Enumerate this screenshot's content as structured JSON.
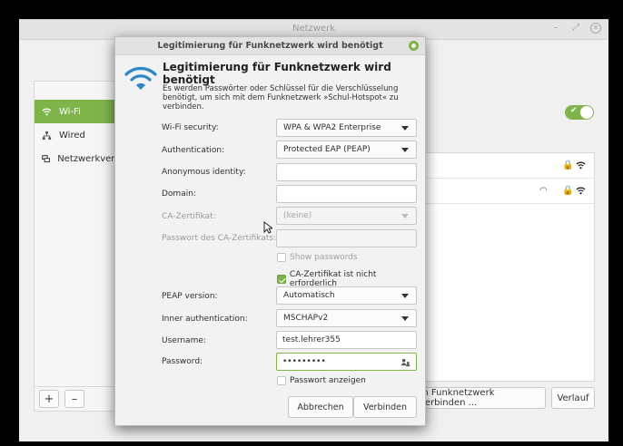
{
  "window": {
    "title": "Netzwerk",
    "minimize": "–",
    "maximize": "⤢",
    "close": "✕"
  },
  "sidebar": {
    "items": [
      {
        "label": "Wi-Fi",
        "icon": "wifi-icon"
      },
      {
        "label": "Wired",
        "icon": "wired-icon"
      },
      {
        "label": "Netzwerkverm",
        "icon": "vpn-icon"
      }
    ]
  },
  "bottom": {
    "add": "+",
    "remove": "–",
    "connect_hidden": "m Funknetzwerk verbinden ...",
    "history": "Verlauf"
  },
  "dialog": {
    "title": "Legitimierung für Funknetzwerk wird benötigt",
    "heading": "Legitimierung für Funknetzwerk wird benötigt",
    "description": "Es werden Passwörter oder Schlüssel für die Verschlüsselung benötigt, um sich mit dem Funknetzwerk »Schul-Hotspot« zu verbinden.",
    "fields": {
      "wifi_security": {
        "label": "Wi-Fi security:",
        "value": "WPA & WPA2 Enterprise"
      },
      "authentication": {
        "label": "Authentication:",
        "value": "Protected EAP (PEAP)"
      },
      "anonymous_identity": {
        "label": "Anonymous identity:",
        "value": ""
      },
      "domain": {
        "label": "Domain:",
        "value": ""
      },
      "ca_cert": {
        "label": "CA-Zertifikat:",
        "value": "(keine)"
      },
      "ca_password": {
        "label": "Passwort des CA-Zertifikats:",
        "value": ""
      },
      "peap_version": {
        "label": "PEAP version:",
        "value": "Automatisch"
      },
      "inner_auth": {
        "label": "Inner authentication:",
        "value": "MSCHAPv2"
      },
      "username": {
        "label": "Username:",
        "value": "test.lehrer355"
      },
      "password": {
        "label": "Password:",
        "value": "•••••••••"
      }
    },
    "show_passwords": "Show passwords",
    "ca_not_required": "CA-Zertifikat ist nicht erforderlich",
    "show_password": "Passwort anzeigen",
    "cancel": "Abbrechen",
    "connect": "Verbinden"
  },
  "colors": {
    "accent": "#7fb44a"
  }
}
